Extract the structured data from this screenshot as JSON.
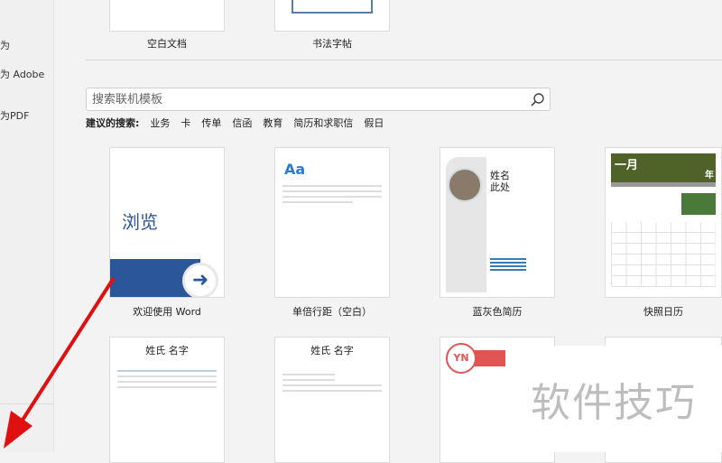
{
  "sidebar": {
    "items": [
      "为",
      "为 Adobe",
      "为PDF"
    ]
  },
  "top_templates": [
    {
      "label": "空白文档"
    },
    {
      "label": "书法字帖"
    }
  ],
  "search": {
    "placeholder": "搜索联机模板"
  },
  "suggested": {
    "label": "建议的搜索:",
    "items": [
      "业务",
      "卡",
      "传单",
      "信函",
      "教育",
      "简历和求职信",
      "假日"
    ]
  },
  "templates": [
    {
      "label": "欢迎使用 Word",
      "thumb_text": "浏览"
    },
    {
      "label": "单倍行距（空白）",
      "thumb_text": "Aa"
    },
    {
      "label": "蓝灰色简历",
      "thumb_text": "姓名\n此处"
    },
    {
      "label": "快照日历",
      "thumb_text": "一月",
      "thumb_sub": "年"
    }
  ],
  "row2": [
    {
      "thumb_text": "姓氏 名字"
    },
    {
      "thumb_text": "姓氏 名字"
    },
    {
      "thumb_text": "YN"
    }
  ],
  "watermark": "软件技巧",
  "colors": {
    "accent": "#2b579a",
    "calendar": "#4f6228",
    "resume_red": "#e05454",
    "arrow": "#e01010"
  }
}
